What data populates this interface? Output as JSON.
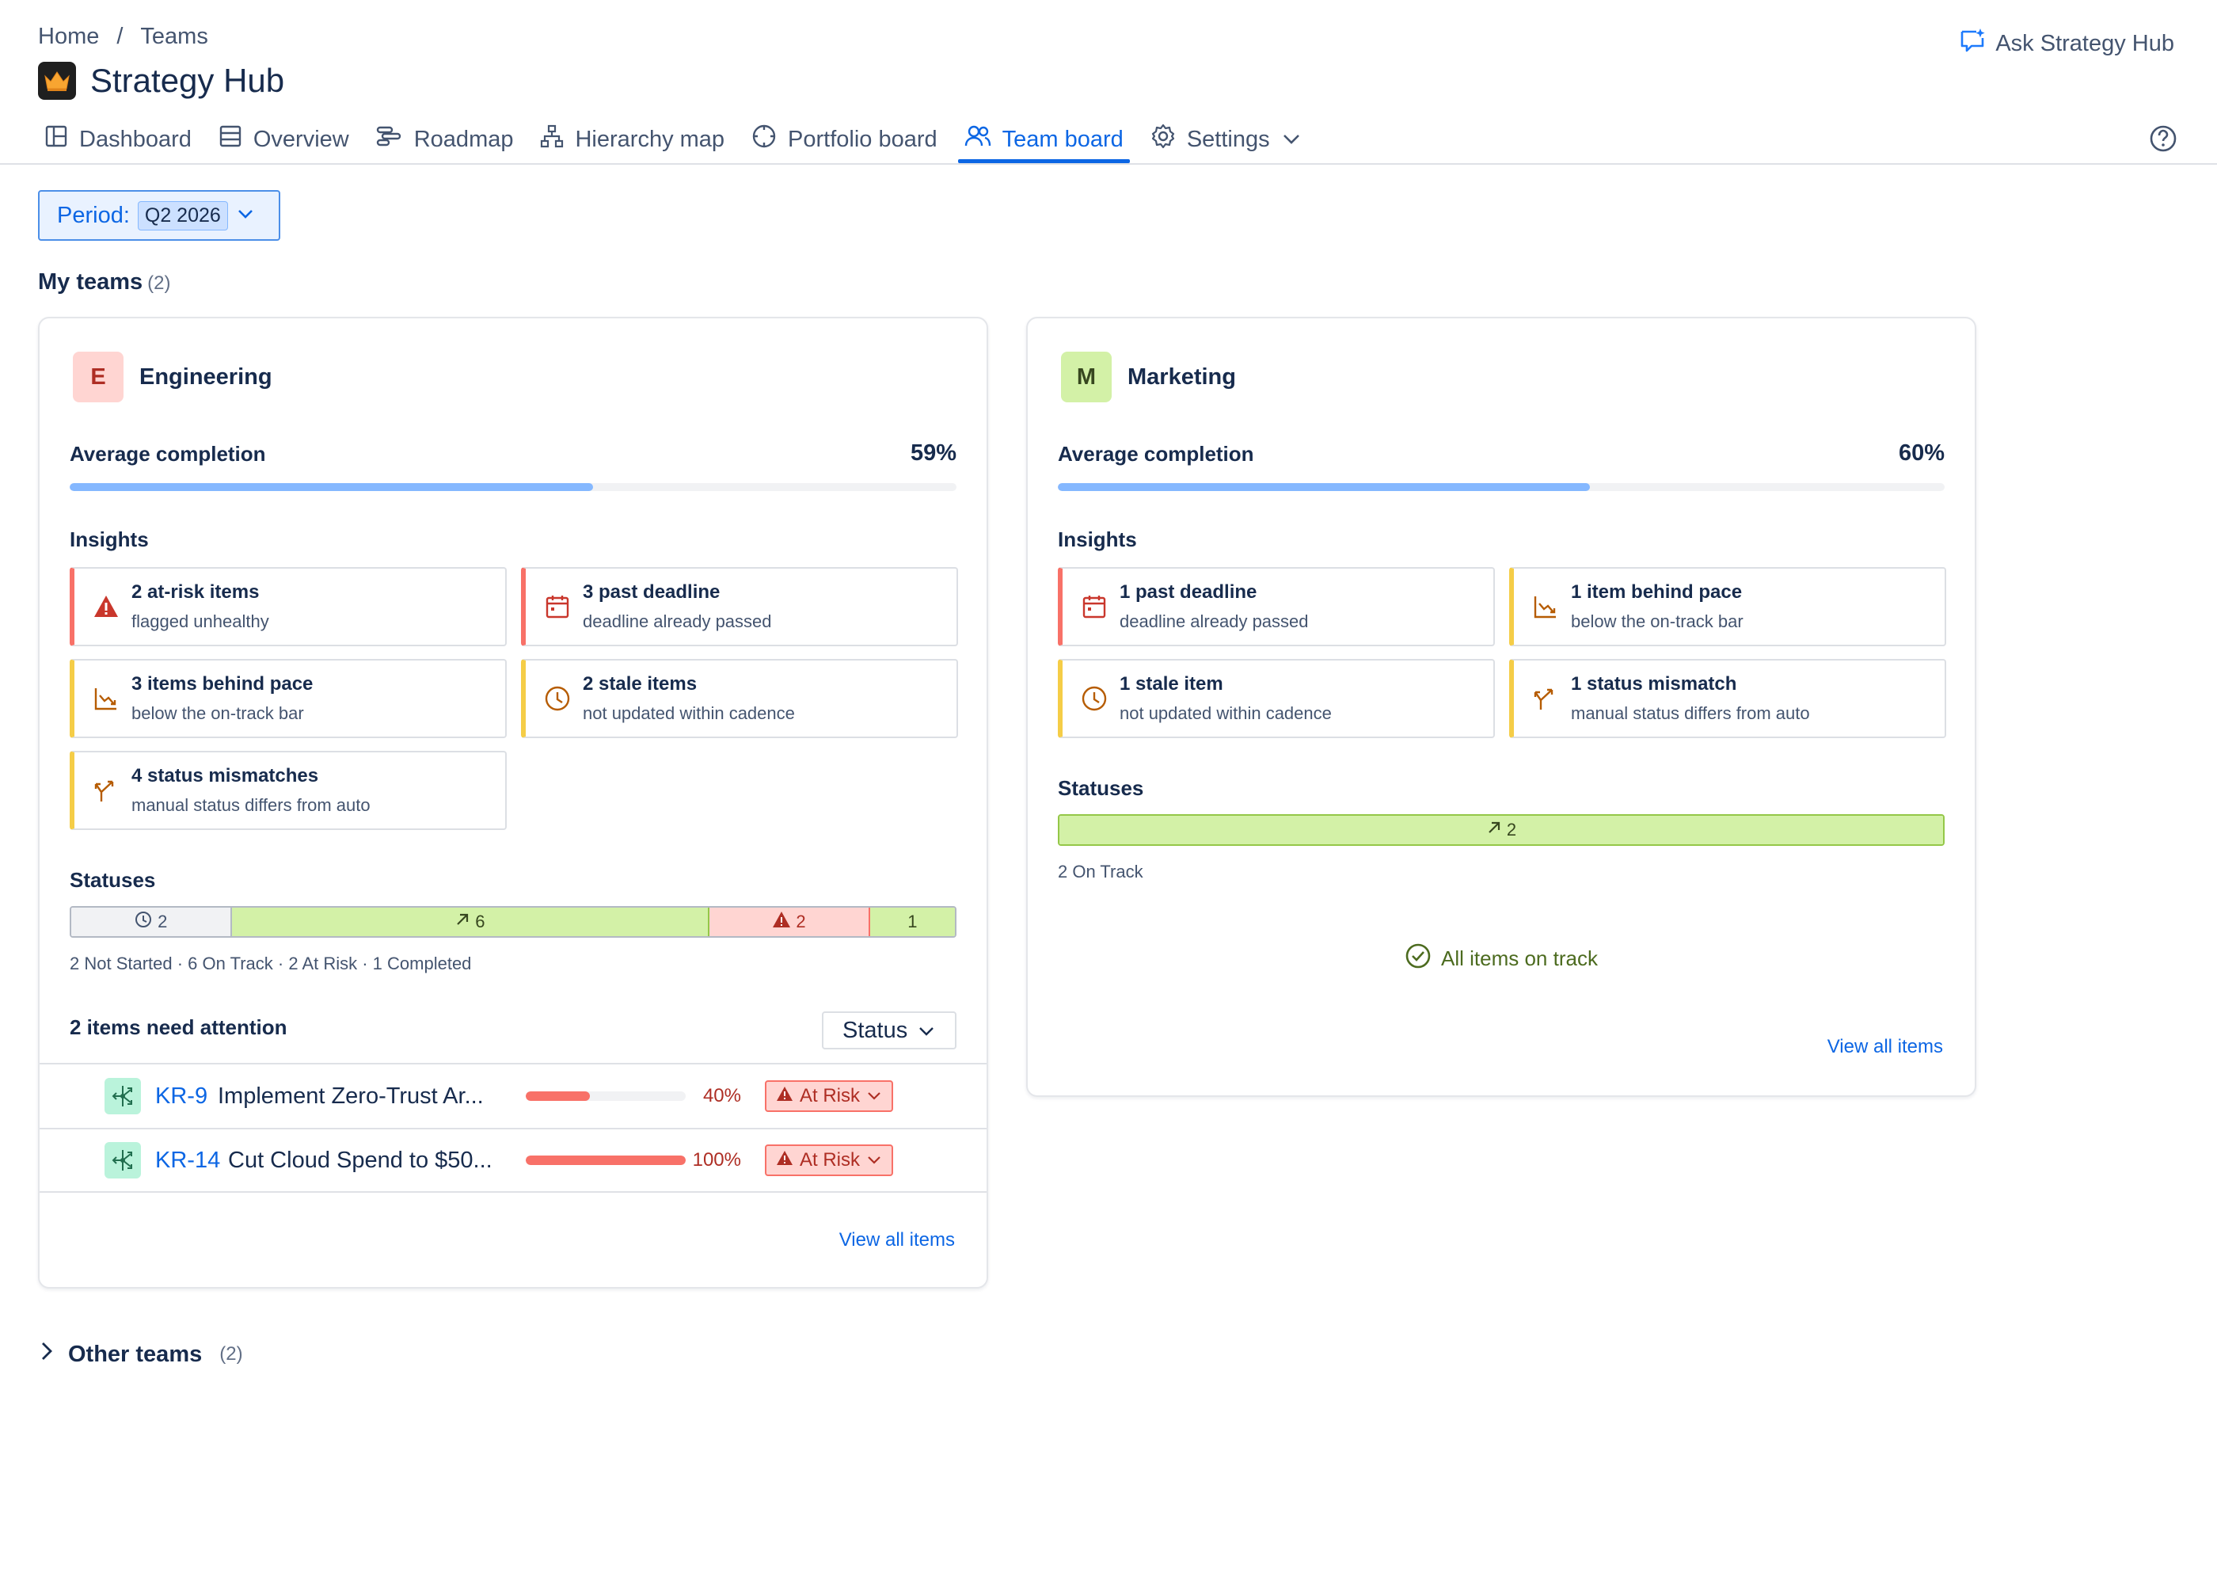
{
  "breadcrumb": {
    "home": "Home",
    "separator": "/",
    "teams": "Teams"
  },
  "app": {
    "title": "Strategy Hub",
    "ask_label": "Ask Strategy Hub"
  },
  "nav": {
    "dashboard": "Dashboard",
    "overview": "Overview",
    "roadmap": "Roadmap",
    "hierarchy": "Hierarchy map",
    "portfolio": "Portfolio board",
    "team_board": "Team board",
    "settings": "Settings"
  },
  "period": {
    "label": "Period:",
    "value": "Q2 2026"
  },
  "my_teams": {
    "title": "My teams",
    "count": "(2)"
  },
  "teams": {
    "engineering": {
      "initial": "E",
      "name": "Engineering",
      "avg_label": "Average completion",
      "avg_value": "59%",
      "avg_fraction": 0.59,
      "insights_title": "Insights",
      "insights": [
        {
          "title": "2 at-risk items",
          "desc": "flagged unhealthy",
          "icon": "warning-icon"
        },
        {
          "title": "3 past deadline",
          "desc": "deadline already passed",
          "icon": "calendar-icon"
        },
        {
          "title": "3 items behind pace",
          "desc": "below the on-track bar",
          "icon": "trend-down-icon"
        },
        {
          "title": "2 stale items",
          "desc": "not updated within cadence",
          "icon": "clock-icon"
        },
        {
          "title": "4 status mismatches",
          "desc": "manual status differs from auto",
          "icon": "split-icon"
        }
      ],
      "statuses_title": "Statuses",
      "statuses": {
        "not_started": "2",
        "on_track": "6",
        "at_risk": "2",
        "completed": "1"
      },
      "status_legend": "2 Not Started ·  6 On Track ·  2 At Risk ·  1 Completed",
      "attention_title": "2 items need attention",
      "status_filter": "Status",
      "items": [
        {
          "key": "KR-9",
          "title": "Implement Zero-Trust Ar...",
          "pct": "40%",
          "fraction": 0.4,
          "status": "At Risk"
        },
        {
          "key": "KR-14",
          "title": "Cut Cloud Spend to $50...",
          "pct": "100%",
          "fraction": 1.0,
          "status": "At Risk"
        }
      ],
      "view_all": "View all items"
    },
    "marketing": {
      "initial": "M",
      "name": "Marketing",
      "avg_label": "Average completion",
      "avg_value": "60%",
      "avg_fraction": 0.6,
      "insights_title": "Insights",
      "insights": [
        {
          "title": "1 past deadline",
          "desc": "deadline already passed",
          "icon": "calendar-icon"
        },
        {
          "title": "1 item behind pace",
          "desc": "below the on-track bar",
          "icon": "trend-down-icon"
        },
        {
          "title": "1 stale item",
          "desc": "not updated within cadence",
          "icon": "clock-icon"
        },
        {
          "title": "1 status mismatch",
          "desc": "manual status differs from auto",
          "icon": "split-icon"
        }
      ],
      "statuses_title": "Statuses",
      "statuses": {
        "on_track": "2"
      },
      "status_legend": "2 On Track",
      "ontrack_message": "All items on track",
      "view_all": "View all items"
    }
  },
  "other_teams": {
    "title": "Other teams",
    "count": "(2)"
  },
  "colors": {
    "accent": "#0c66e4",
    "progress": "#85b8ff",
    "at_risk": "#f87168",
    "on_track": "#d3f1a7",
    "warning": "#f5cd47"
  }
}
